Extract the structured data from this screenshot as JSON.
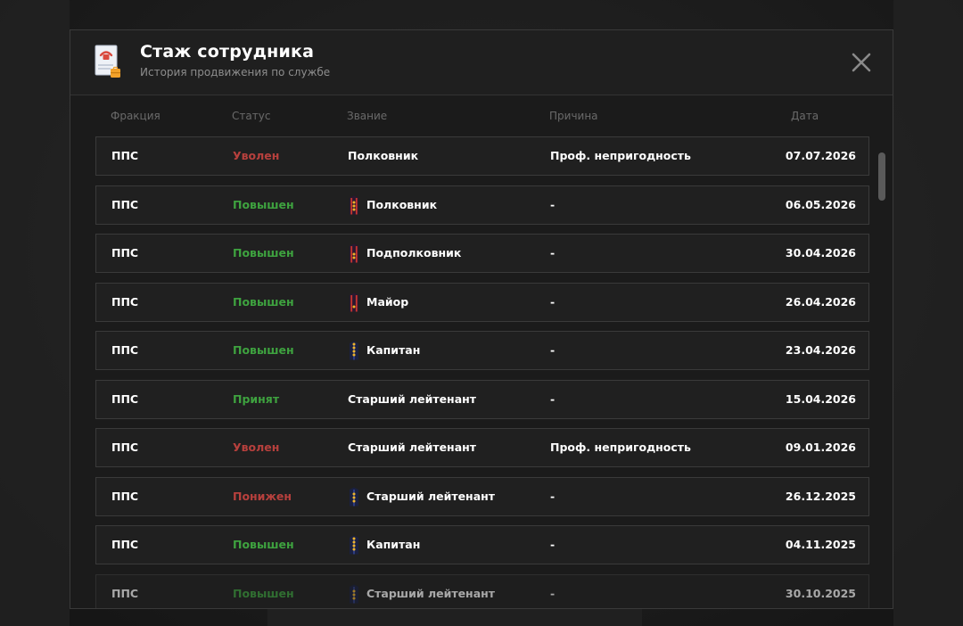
{
  "header": {
    "title": "Стаж сотрудника",
    "subtitle": "История продвижения по службе"
  },
  "columns": {
    "fraction": "Фракция",
    "status": "Статус",
    "rank": "Звание",
    "reason": "Причина",
    "date": "Дата"
  },
  "colors": {
    "dismissed": "#b7403d",
    "promoted": "#3ea23f",
    "text": "#ffffff"
  },
  "rows": [
    {
      "fraction": "ППС",
      "status": "Уволен",
      "status_color": "red",
      "rank": "Полковник",
      "rank_icon": "",
      "reason": "Проф. непригодность",
      "date": "07.07.2026"
    },
    {
      "fraction": "ППС",
      "status": "Повышен",
      "status_color": "green",
      "rank": "Полковник",
      "rank_icon": "colonel-epaulette-icon",
      "reason": "-",
      "date": "06.05.2026"
    },
    {
      "fraction": "ППС",
      "status": "Повышен",
      "status_color": "green",
      "rank": "Подполковник",
      "rank_icon": "lt-colonel-epaulette-icon",
      "reason": "-",
      "date": "30.04.2026"
    },
    {
      "fraction": "ППС",
      "status": "Повышен",
      "status_color": "green",
      "rank": "Майор",
      "rank_icon": "major-epaulette-icon",
      "reason": "-",
      "date": "26.04.2026"
    },
    {
      "fraction": "ППС",
      "status": "Повышен",
      "status_color": "green",
      "rank": "Капитан",
      "rank_icon": "captain-epaulette-icon",
      "reason": "-",
      "date": "23.04.2026"
    },
    {
      "fraction": "ППС",
      "status": "Принят",
      "status_color": "green",
      "rank": "Старший лейтенант",
      "rank_icon": "",
      "reason": "-",
      "date": "15.04.2026"
    },
    {
      "fraction": "ППС",
      "status": "Уволен",
      "status_color": "red",
      "rank": "Старший лейтенант",
      "rank_icon": "",
      "reason": "Проф. непригодность",
      "date": "09.01.2026"
    },
    {
      "fraction": "ППС",
      "status": "Понижен",
      "status_color": "red",
      "rank": "Старший лейтенант",
      "rank_icon": "senior-lieutenant-epaulette-icon",
      "reason": "-",
      "date": "26.12.2025"
    },
    {
      "fraction": "ППС",
      "status": "Повышен",
      "status_color": "green",
      "rank": "Капитан",
      "rank_icon": "captain-epaulette-icon",
      "reason": "-",
      "date": "04.11.2025"
    },
    {
      "fraction": "ППС",
      "status": "Повышен",
      "status_color": "green",
      "rank": "Старший лейтенант",
      "rank_icon": "senior-lieutenant-epaulette-icon",
      "reason": "-",
      "date": "30.10.2025"
    }
  ]
}
